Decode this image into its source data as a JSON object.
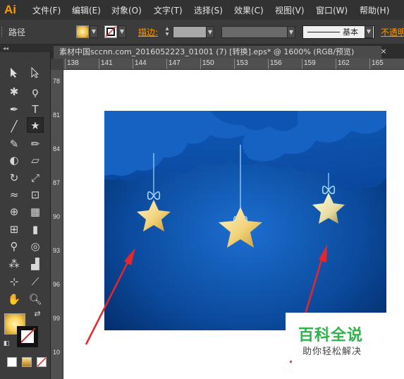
{
  "app": {
    "logo": "Ai"
  },
  "menubar": {
    "items": [
      "文件(F)",
      "编辑(E)",
      "对象(O)",
      "文字(T)",
      "选择(S)",
      "效果(C)",
      "视图(V)",
      "窗口(W)",
      "帮助(H)"
    ]
  },
  "control_bar": {
    "selection_label": "路径",
    "stroke_label": "描边:",
    "stroke_profile": "基本",
    "opacity_label": "不透明"
  },
  "tools_panel": {
    "collapse_label": "◂◂"
  },
  "document": {
    "tab_title": "素材中国sccnn.com_2016052223_01001  (7)  [转换].eps* @ 1600% (RGB/预览)",
    "close_glyph": "×"
  },
  "rulers": {
    "horizontal": [
      "138",
      "141",
      "144",
      "147",
      "150",
      "153",
      "156",
      "159",
      "162",
      "165"
    ],
    "vertical": [
      "78",
      "81",
      "84",
      "87",
      "90",
      "93",
      "96",
      "99",
      "10"
    ]
  },
  "watermark": {
    "title": "百科全说",
    "subtitle": "助你轻松解决"
  },
  "colors": {
    "accent": "#ff9a00",
    "arrow": "#e8252a",
    "night_sky": "#0b4a9c",
    "star": "#f2d37a",
    "watermark_green": "#2fb34a"
  }
}
